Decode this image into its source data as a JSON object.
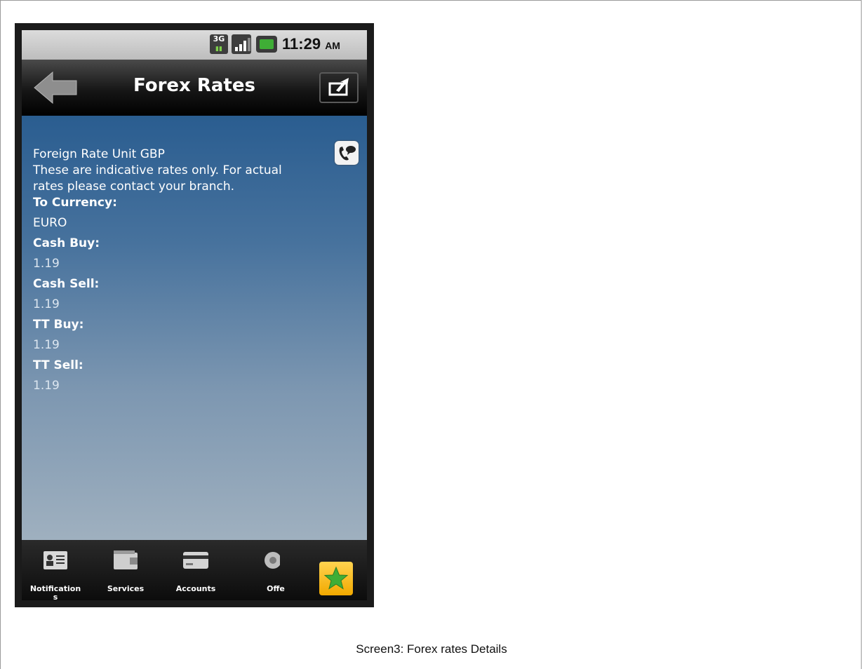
{
  "status_bar": {
    "network": "3G",
    "time": "11:29",
    "ampm": "AM"
  },
  "header": {
    "title": "Forex Rates"
  },
  "content": {
    "line1": "Foreign Rate Unit GBP",
    "line2": "These are indicative rates only. For actual",
    "line3": "rates please contact your branch.",
    "to_currency_label": "To Currency:",
    "to_currency_value": "EURO",
    "cash_buy_label": "Cash Buy:",
    "cash_buy_value": "1.19",
    "cash_sell_label": "Cash Sell:",
    "cash_sell_value": "1.19",
    "tt_buy_label": "TT Buy:",
    "tt_buy_value": "1.19",
    "tt_sell_label": "TT Sell:",
    "tt_sell_value": "1.19"
  },
  "bottom_nav": {
    "items": [
      {
        "label": "Notification",
        "label2": "s",
        "icon": "contact-card-icon"
      },
      {
        "label": "Services",
        "icon": "wallet-icon"
      },
      {
        "label": "Accounts",
        "icon": "credit-card-icon"
      },
      {
        "label": "Offe",
        "icon": "gear-icon"
      }
    ],
    "favorites_icon": "star-icon"
  },
  "caption": "Screen3: Forex rates Details",
  "colors": {
    "content_top": "#2a5d90",
    "content_bottom": "#9fb0bf",
    "favorites": "#f2a900",
    "star": "#3fae36"
  }
}
